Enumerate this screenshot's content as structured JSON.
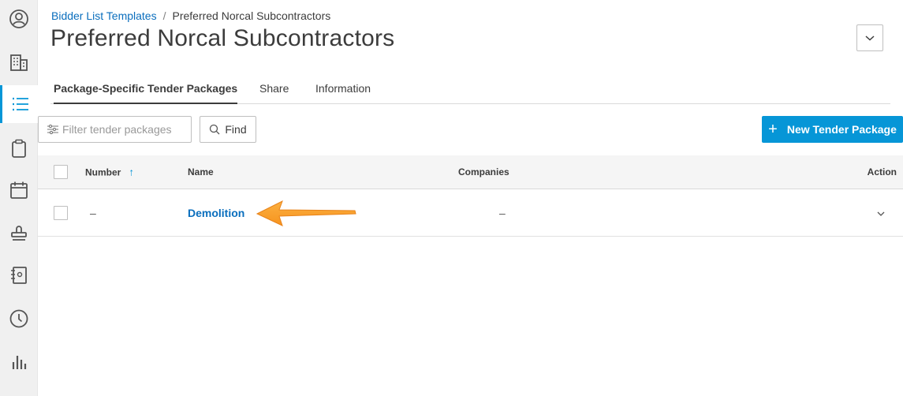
{
  "breadcrumb": {
    "parent": "Bidder List Templates",
    "separator": "/",
    "current": "Preferred Norcal Subcontractors"
  },
  "page_title": "Preferred Norcal Subcontractors",
  "tabs": [
    {
      "label": "Package-Specific Tender Packages",
      "active": true
    },
    {
      "label": "Share",
      "active": false
    },
    {
      "label": "Information",
      "active": false
    }
  ],
  "toolbar": {
    "filter_placeholder": "Filter tender packages",
    "find_label": "Find",
    "new_plus": "+",
    "new_label": "New Tender Package"
  },
  "table": {
    "columns": {
      "number": "Number",
      "number_sort": "↑",
      "name": "Name",
      "companies": "Companies",
      "action": "Action"
    },
    "rows": [
      {
        "number": "–",
        "name": "Demolition",
        "companies": "–"
      }
    ]
  },
  "sidebar": {
    "items": [
      {
        "icon": "user-icon"
      },
      {
        "icon": "building-icon"
      },
      {
        "icon": "list-icon",
        "active": true
      },
      {
        "icon": "clipboard-icon"
      },
      {
        "icon": "calendar-icon"
      },
      {
        "icon": "stamp-icon"
      },
      {
        "icon": "notebook-icon"
      },
      {
        "icon": "clock-icon"
      },
      {
        "icon": "bar-chart-icon"
      }
    ]
  },
  "colors": {
    "accent": "#0696d7",
    "link": "#0a6ebd",
    "annotation_arrow": "#f7931e"
  }
}
